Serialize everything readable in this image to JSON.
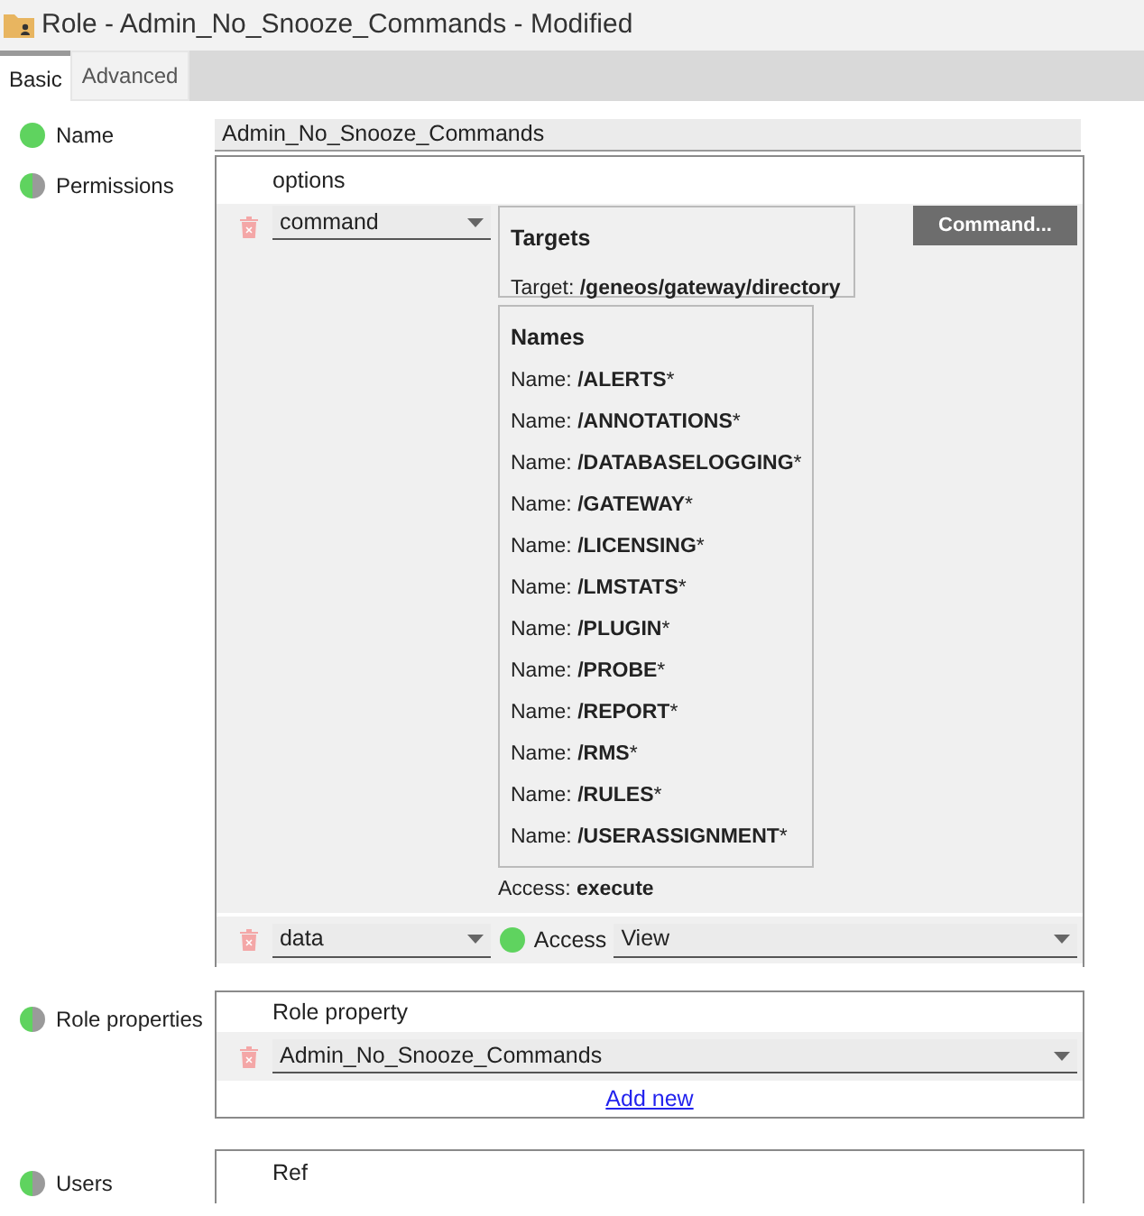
{
  "window": {
    "title": "Role - Admin_No_Snooze_Commands - Modified"
  },
  "tabs": [
    {
      "label": "Basic",
      "selected": true
    },
    {
      "label": "Advanced",
      "selected": false
    }
  ],
  "name_field": {
    "label": "Name",
    "complete": true,
    "value": "Admin_No_Snooze_Commands"
  },
  "permissions": {
    "label": "Permissions",
    "complete": false,
    "header": "options",
    "command_row": {
      "type": "command",
      "targets_title": "Targets",
      "target": "Target: **/geneos/gateway/directory**",
      "button": "Command...",
      "names_title": "Names",
      "names": [
        "Name: **/ALERTS***",
        "Name: **/ANNOTATIONS***",
        "Name: **/DATABASELOGGING***",
        "Name: **/GATEWAY***",
        "Name: **/LICENSING***",
        "Name: **/LMSTATS***",
        "Name: **/PLUGIN***",
        "Name: **/PROBE***",
        "Name: **/REPORT***",
        "Name: **/RMS***",
        "Name: **/RULES***",
        "Name: **/USERASSIGNMENT***"
      ],
      "access": "Access: **execute**"
    },
    "data_row": {
      "type": "data",
      "access_complete": true,
      "access_label": "Access",
      "access_value": "View"
    }
  },
  "role_properties": {
    "label": "Role properties",
    "complete": false,
    "header": "Role property",
    "value": "Admin_No_Snooze_Commands",
    "add_link": "Add new"
  },
  "users": {
    "label": "Users",
    "complete": false,
    "header": "Ref"
  }
}
